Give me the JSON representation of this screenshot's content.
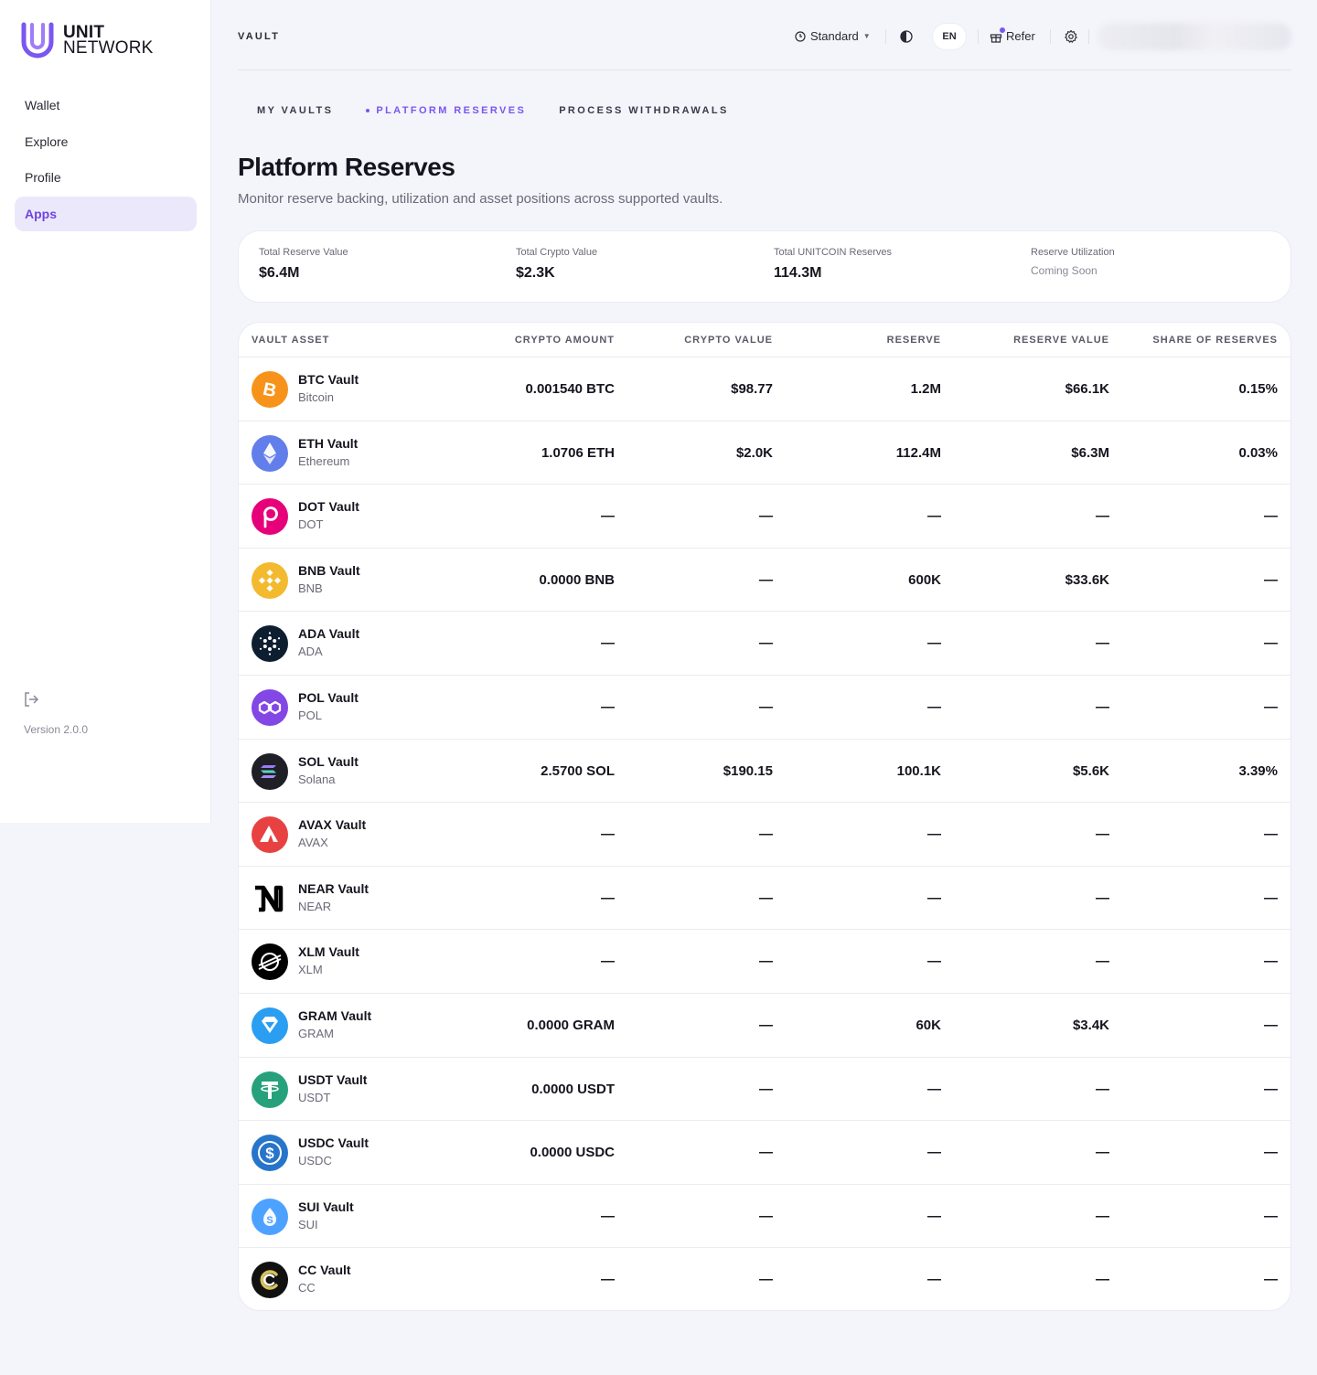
{
  "brand": {
    "line1": "UNIT",
    "line2": "NETWORK",
    "accent": "#6d45e0"
  },
  "sidebar": {
    "items": [
      {
        "label": "Wallet",
        "active": false
      },
      {
        "label": "Explore",
        "active": false
      },
      {
        "label": "Profile",
        "active": false
      },
      {
        "label": "Apps",
        "active": true
      }
    ],
    "version": "Version 2.0.0",
    "logout_icon": "logout-icon"
  },
  "header": {
    "title": "VAULT",
    "mode_label": "Standard",
    "language": "EN",
    "refer_label": "Refer",
    "theme_icon": "contrast-icon",
    "settings_icon": "gear-icon"
  },
  "tabs": [
    {
      "label": "MY VAULTS",
      "active": false
    },
    {
      "label": "PLATFORM RESERVES",
      "active": true
    },
    {
      "label": "PROCESS WITHDRAWALS",
      "active": false
    }
  ],
  "page": {
    "title": "Platform Reserves",
    "subtitle": "Monitor reserve backing, utilization and asset positions across supported vaults."
  },
  "summary": [
    {
      "label": "Total Reserve Value",
      "value": "$6.4M"
    },
    {
      "label": "Total Crypto Value",
      "value": "$2.3K"
    },
    {
      "label": "Total UNITCOIN Reserves",
      "value": "114.3M"
    },
    {
      "label": "Reserve Utilization",
      "value": "Coming Soon"
    }
  ],
  "table": {
    "headers": [
      "VAULT ASSET",
      "CRYPTO AMOUNT",
      "CRYPTO VALUE",
      "RESERVE",
      "RESERVE VALUE",
      "SHARE OF RESERVES"
    ],
    "rows": [
      {
        "name": "BTC Vault",
        "sub": "Bitcoin",
        "icon": "bitcoin-icon",
        "color": "#f7931a",
        "amount": "0.001540 BTC",
        "crypto_value": "$98.77",
        "reserve": "1.2M",
        "reserve_value": "$66.1K",
        "share": "0.15%"
      },
      {
        "name": "ETH Vault",
        "sub": "Ethereum",
        "icon": "ethereum-icon",
        "color": "#627eea",
        "amount": "1.0706 ETH",
        "crypto_value": "$2.0K",
        "reserve": "112.4M",
        "reserve_value": "$6.3M",
        "share": "0.03%"
      },
      {
        "name": "DOT Vault",
        "sub": "DOT",
        "icon": "polkadot-icon",
        "color": "#e6007a",
        "amount": "—",
        "crypto_value": "—",
        "reserve": "—",
        "reserve_value": "—",
        "share": "—"
      },
      {
        "name": "BNB Vault",
        "sub": "BNB",
        "icon": "bnb-icon",
        "color": "#f3ba2f",
        "amount": "0.0000 BNB",
        "crypto_value": "—",
        "reserve": "600K",
        "reserve_value": "$33.6K",
        "share": "—"
      },
      {
        "name": "ADA Vault",
        "sub": "ADA",
        "icon": "cardano-icon",
        "color": "#0d1e30",
        "amount": "—",
        "crypto_value": "—",
        "reserve": "—",
        "reserve_value": "—",
        "share": "—"
      },
      {
        "name": "POL Vault",
        "sub": "POL",
        "icon": "polygon-icon",
        "color": "#8247e5",
        "amount": "—",
        "crypto_value": "—",
        "reserve": "—",
        "reserve_value": "—",
        "share": "—"
      },
      {
        "name": "SOL Vault",
        "sub": "Solana",
        "icon": "solana-icon",
        "color": "#1f1f26",
        "amount": "2.5700 SOL",
        "crypto_value": "$190.15",
        "reserve": "100.1K",
        "reserve_value": "$5.6K",
        "share": "3.39%"
      },
      {
        "name": "AVAX Vault",
        "sub": "AVAX",
        "icon": "avalanche-icon",
        "color": "#e84142",
        "amount": "—",
        "crypto_value": "—",
        "reserve": "—",
        "reserve_value": "—",
        "share": "—"
      },
      {
        "name": "NEAR Vault",
        "sub": "NEAR",
        "icon": "near-icon",
        "color": "#ffffff",
        "amount": "—",
        "crypto_value": "—",
        "reserve": "—",
        "reserve_value": "—",
        "share": "—"
      },
      {
        "name": "XLM Vault",
        "sub": "XLM",
        "icon": "stellar-icon",
        "color": "#000000",
        "amount": "—",
        "crypto_value": "—",
        "reserve": "—",
        "reserve_value": "—",
        "share": "—"
      },
      {
        "name": "GRAM Vault",
        "sub": "GRAM",
        "icon": "gram-icon",
        "color": "#2a9ef1",
        "amount": "0.0000 GRAM",
        "crypto_value": "—",
        "reserve": "60K",
        "reserve_value": "$3.4K",
        "share": "—"
      },
      {
        "name": "USDT Vault",
        "sub": "USDT",
        "icon": "tether-icon",
        "color": "#26a17b",
        "amount": "0.0000 USDT",
        "crypto_value": "—",
        "reserve": "—",
        "reserve_value": "—",
        "share": "—"
      },
      {
        "name": "USDC Vault",
        "sub": "USDC",
        "icon": "usdc-icon",
        "color": "#2775ca",
        "amount": "0.0000 USDC",
        "crypto_value": "—",
        "reserve": "—",
        "reserve_value": "—",
        "share": "—"
      },
      {
        "name": "SUI Vault",
        "sub": "SUI",
        "icon": "sui-icon",
        "color": "#4da2ff",
        "amount": "—",
        "crypto_value": "—",
        "reserve": "—",
        "reserve_value": "—",
        "share": "—"
      },
      {
        "name": "CC Vault",
        "sub": "CC",
        "icon": "cc-icon",
        "color": "#111111",
        "amount": "—",
        "crypto_value": "—",
        "reserve": "—",
        "reserve_value": "—",
        "share": "—"
      }
    ]
  }
}
